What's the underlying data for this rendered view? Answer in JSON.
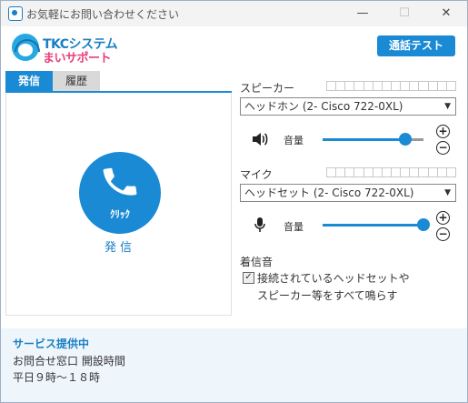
{
  "window": {
    "title": "お気軽にお問い合わせください",
    "minimize": "—",
    "maximize": "☐",
    "close": "✕"
  },
  "brand": {
    "line1": "TKCシステム",
    "line2": "まいサポート"
  },
  "header": {
    "test_call_label": "通話テスト"
  },
  "tabs": [
    {
      "label": "発信",
      "active": true
    },
    {
      "label": "履歴",
      "active": false
    }
  ],
  "call": {
    "button_text": "ｸﾘｯｸ",
    "label": "発信"
  },
  "speaker": {
    "label": "スピーカー",
    "device": "ヘッドホン (2- Cisco 722-0XL)",
    "volume_label": "音量",
    "volume": 0.82
  },
  "mic": {
    "label": "マイク",
    "device": "ヘッドセット (2- Cisco 722-0XL)",
    "volume_label": "音量",
    "volume": 1.0
  },
  "ringtone": {
    "label": "着信音",
    "checked": true,
    "line1": "接続されているヘッドセットや",
    "line2": "スピーカー等をすべて鳴らす"
  },
  "footer": {
    "status": "サービス提供中",
    "hours_title": "お問合せ窓口 開設時間",
    "hours": "平日９時～１８時"
  },
  "colors": {
    "accent": "#1a8ad4",
    "brand_pink": "#e8407a",
    "footer_bg": "#eef5fb"
  }
}
